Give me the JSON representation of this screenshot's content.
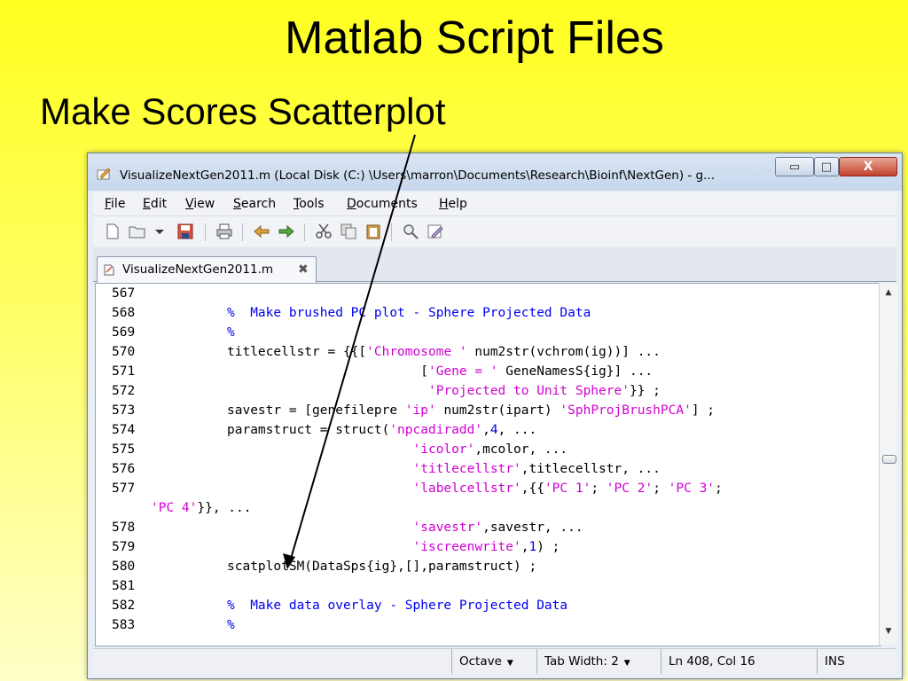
{
  "slide": {
    "title": "Matlab Script Files",
    "subtitle": "Make Scores Scatterplot"
  },
  "window": {
    "title": "VisualizeNextGen2011.m (Local Disk (C:) \\Users\\marron\\Documents\\Research\\Bioinf\\NextGen) - g...",
    "buttons": {
      "minimize": "▭",
      "maximize": "□",
      "close": "X"
    }
  },
  "menubar": {
    "items": [
      {
        "key": "F",
        "rest": "ile"
      },
      {
        "key": "E",
        "rest": "dit"
      },
      {
        "key": "V",
        "rest": "iew"
      },
      {
        "key": "S",
        "rest": "earch"
      },
      {
        "key": "T",
        "rest": "ools"
      },
      {
        "key": "D",
        "rest": "ocuments"
      },
      {
        "key": "H",
        "rest": "elp"
      }
    ]
  },
  "toolbar": {
    "icons": [
      "new-file-icon",
      "open-folder-icon",
      "dropdown-arrow-icon",
      "save-icon",
      "print-icon",
      "undo-icon",
      "redo-icon",
      "cut-icon",
      "copy-icon",
      "paste-icon",
      "find-icon",
      "replace-icon"
    ]
  },
  "tab": {
    "label": "VisualizeNextGen2011.m",
    "close": "✖"
  },
  "code": {
    "lines": [
      {
        "num": "567",
        "segments": []
      },
      {
        "num": "568",
        "segments": [
          {
            "t": "c",
            "v": "%  Make brushed PC plot - Sphere Projected Data"
          }
        ]
      },
      {
        "num": "569",
        "segments": [
          {
            "t": "c",
            "v": "%"
          }
        ]
      },
      {
        "num": "570",
        "segments": [
          {
            "t": "p",
            "v": "titlecellstr = {{["
          },
          {
            "t": "s",
            "v": "'Chromosome '"
          },
          {
            "t": "p",
            "v": " num2str(vchrom(ig))] ..."
          }
        ]
      },
      {
        "num": "571",
        "segments": [
          {
            "t": "p",
            "v": "                         ["
          },
          {
            "t": "s",
            "v": "'Gene = '"
          },
          {
            "t": "p",
            "v": " GeneNamesS{ig}] ..."
          }
        ]
      },
      {
        "num": "572",
        "segments": [
          {
            "t": "p",
            "v": "                          "
          },
          {
            "t": "s",
            "v": "'Projected to Unit Sphere'"
          },
          {
            "t": "p",
            "v": "}} ;"
          }
        ]
      },
      {
        "num": "573",
        "segments": [
          {
            "t": "p",
            "v": "savestr = [genefilepre "
          },
          {
            "t": "s",
            "v": "'ip'"
          },
          {
            "t": "p",
            "v": " num2str(ipart) "
          },
          {
            "t": "s",
            "v": "'SphProjBrushPCA'"
          },
          {
            "t": "p",
            "v": "] ;"
          }
        ]
      },
      {
        "num": "574",
        "segments": [
          {
            "t": "p",
            "v": "paramstruct = struct("
          },
          {
            "t": "s",
            "v": "'npcadiradd'"
          },
          {
            "t": "p",
            "v": ","
          },
          {
            "t": "n",
            "v": "4"
          },
          {
            "t": "p",
            "v": ", ..."
          }
        ]
      },
      {
        "num": "575",
        "segments": [
          {
            "t": "p",
            "v": "                        "
          },
          {
            "t": "s",
            "v": "'icolor'"
          },
          {
            "t": "p",
            "v": ",mcolor, ..."
          }
        ]
      },
      {
        "num": "576",
        "segments": [
          {
            "t": "p",
            "v": "                        "
          },
          {
            "t": "s",
            "v": "'titlecellstr'"
          },
          {
            "t": "p",
            "v": ",titlecellstr, ..."
          }
        ]
      },
      {
        "num": "577",
        "segments": [
          {
            "t": "p",
            "v": "                        "
          },
          {
            "t": "s",
            "v": "'labelcellstr'"
          },
          {
            "t": "p",
            "v": ",{{"
          },
          {
            "t": "s",
            "v": "'PC 1'"
          },
          {
            "t": "p",
            "v": "; "
          },
          {
            "t": "s",
            "v": "'PC 2'"
          },
          {
            "t": "p",
            "v": "; "
          },
          {
            "t": "s",
            "v": "'PC 3'"
          },
          {
            "t": "p",
            "v": ";"
          }
        ]
      },
      {
        "num": "",
        "wrap": true,
        "segments": [
          {
            "t": "s",
            "v": "'PC 4'"
          },
          {
            "t": "p",
            "v": "}}, ..."
          }
        ]
      },
      {
        "num": "578",
        "segments": [
          {
            "t": "p",
            "v": "                        "
          },
          {
            "t": "s",
            "v": "'savestr'"
          },
          {
            "t": "p",
            "v": ",savestr, ..."
          }
        ]
      },
      {
        "num": "579",
        "segments": [
          {
            "t": "p",
            "v": "                        "
          },
          {
            "t": "s",
            "v": "'iscreenwrite'"
          },
          {
            "t": "p",
            "v": ","
          },
          {
            "t": "n",
            "v": "1"
          },
          {
            "t": "p",
            "v": ") ;"
          }
        ]
      },
      {
        "num": "580",
        "segments": [
          {
            "t": "p",
            "v": "scatplotSM(DataSps{ig},[],paramstruct) ;"
          }
        ]
      },
      {
        "num": "581",
        "segments": []
      },
      {
        "num": "582",
        "segments": [
          {
            "t": "c",
            "v": "%  Make data overlay - Sphere Projected Data"
          }
        ]
      },
      {
        "num": "583",
        "segments": [
          {
            "t": "c",
            "v": "%"
          }
        ]
      }
    ]
  },
  "statusbar": {
    "language": "Octave",
    "tab_width": "Tab Width:  2",
    "position": "Ln 408, Col 16",
    "mode": "INS"
  },
  "colors": {
    "comment": "#0000ee",
    "string": "#d100d1",
    "number": "#0000ee",
    "slide_background": "#ffff33"
  }
}
